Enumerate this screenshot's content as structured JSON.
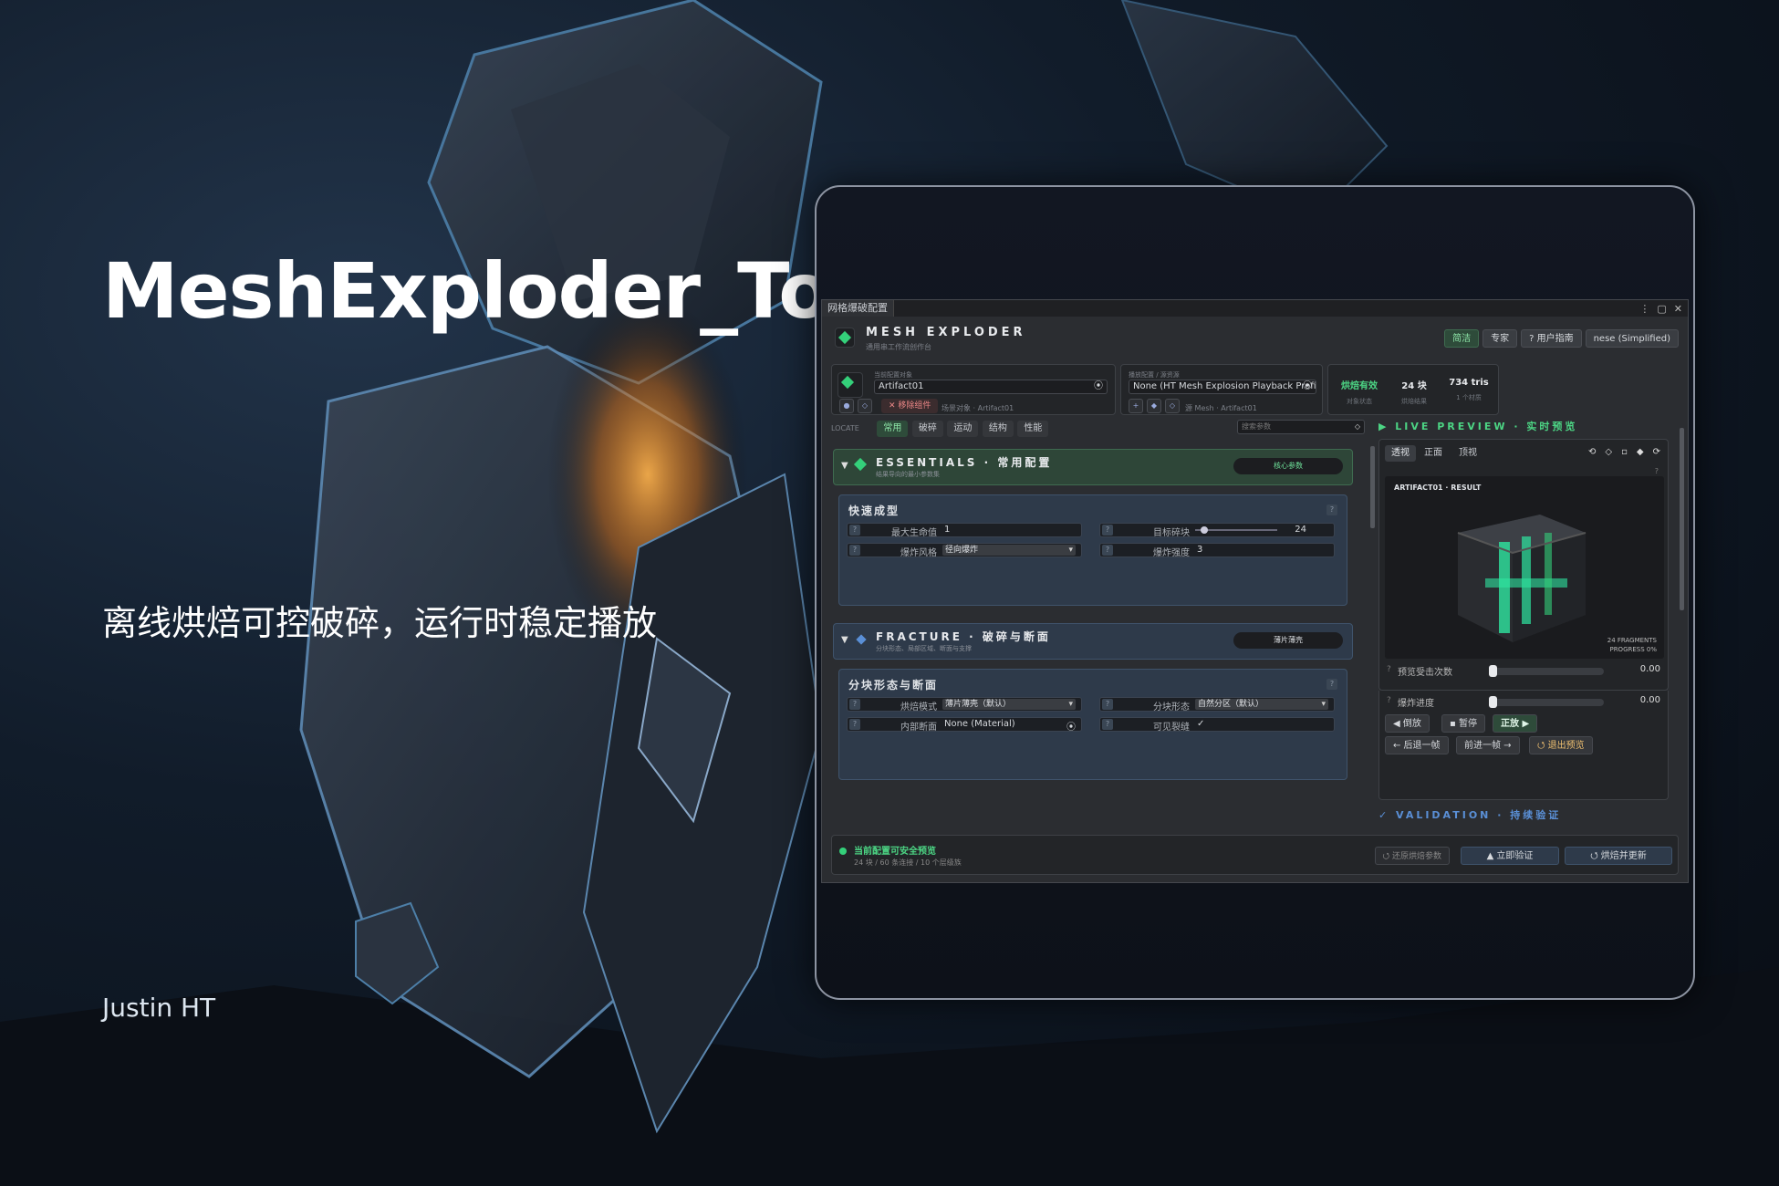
{
  "poster": {
    "title": "MeshExploder_Tool",
    "subtitle": "离线烘焙可控破碎，运行时稳定播放",
    "author": "Justin HT"
  },
  "window": {
    "tab": "网格爆破配置",
    "ctrl_more": "⋮",
    "ctrl_max": "▢",
    "ctrl_close": "✕"
  },
  "header": {
    "app_name": "MESH EXPLODER",
    "app_sub": "通用串工作流创作台",
    "btn_simple": "简洁",
    "btn_expert": "专家",
    "btn_guide": "? 用户指南",
    "btn_lang": "nese (Simplified)"
  },
  "target": {
    "label": "当前配置对象",
    "value": "Artifact01",
    "remove": "✕ 移除组件",
    "scene": "场景对象 · Artifact01"
  },
  "playback": {
    "label": "播放配置 / 源资源",
    "value": "None (HT Mesh Explosion Playback Profi",
    "mesh": "源 Mesh · Artifact01"
  },
  "stats": [
    {
      "v": "烘焙有效",
      "s": "对象状态"
    },
    {
      "v": "24 块",
      "s": "烘焙结果"
    },
    {
      "v": "734 tris",
      "s": "1 个材质"
    }
  ],
  "nav": {
    "locate": "LOCATE",
    "tabs": [
      "常用",
      "破碎",
      "运动",
      "结构",
      "性能"
    ],
    "search_placeholder": "搜索参数"
  },
  "essentials": {
    "title": "ESSENTIALS · 常用配置",
    "sub": "结果导向的最小参数集",
    "pill": "核心参数",
    "group": "快速成型",
    "rows": [
      {
        "k": "最大生命值",
        "v": "1"
      },
      {
        "k": "目标碎块",
        "v": "24"
      },
      {
        "k": "爆炸风格",
        "v": "径向爆炸"
      },
      {
        "k": "爆炸强度",
        "v": "3"
      }
    ]
  },
  "fracture": {
    "title": "FRACTURE · 破碎与断面",
    "sub": "分块形态、局部区域、断面与支撑",
    "pill": "薄片薄壳",
    "group": "分块形态与断面",
    "rows": [
      {
        "k": "烘焙模式",
        "v": "薄片薄壳（默认）"
      },
      {
        "k": "分块形态",
        "v": "自然分区（默认）"
      },
      {
        "k": "内部断面",
        "v": "None (Material)"
      },
      {
        "k": "可见裂缝",
        "v": "✓"
      }
    ]
  },
  "preview": {
    "title": "▶ LIVE PREVIEW · 实时预览",
    "views": [
      "透视",
      "正面",
      "顶视"
    ],
    "result": "ARTIFACT01 · RESULT",
    "frag": "24 FRAGMENTS",
    "progress": "PROGRESS 0%",
    "hits_label": "预览受击次数",
    "hits_val": "0.00",
    "hits_frac": 0.0,
    "blast_label": "爆炸进度",
    "blast_val": "0.00",
    "blast_frac": 0.0,
    "btn_rev": "◀ 倒放",
    "btn_pause": "▪ 暂停",
    "btn_play": "正放 ▶",
    "btn_back": "← 后退一帧",
    "btn_fwd": "前进一帧 →",
    "btn_exit": "⭯ 退出预览",
    "validation": "✓ VALIDATION · 持续验证"
  },
  "footer": {
    "status": "当前配置可安全预览",
    "detail": "24 块 / 60 条连接 / 10 个层级族",
    "btn_restore": "⭯ 还原烘焙参数",
    "btn_verify": "▲ 立即验证",
    "btn_bake": "⭯ 烘焙并更新"
  },
  "icons": {
    "q": "?",
    "help": "?"
  }
}
